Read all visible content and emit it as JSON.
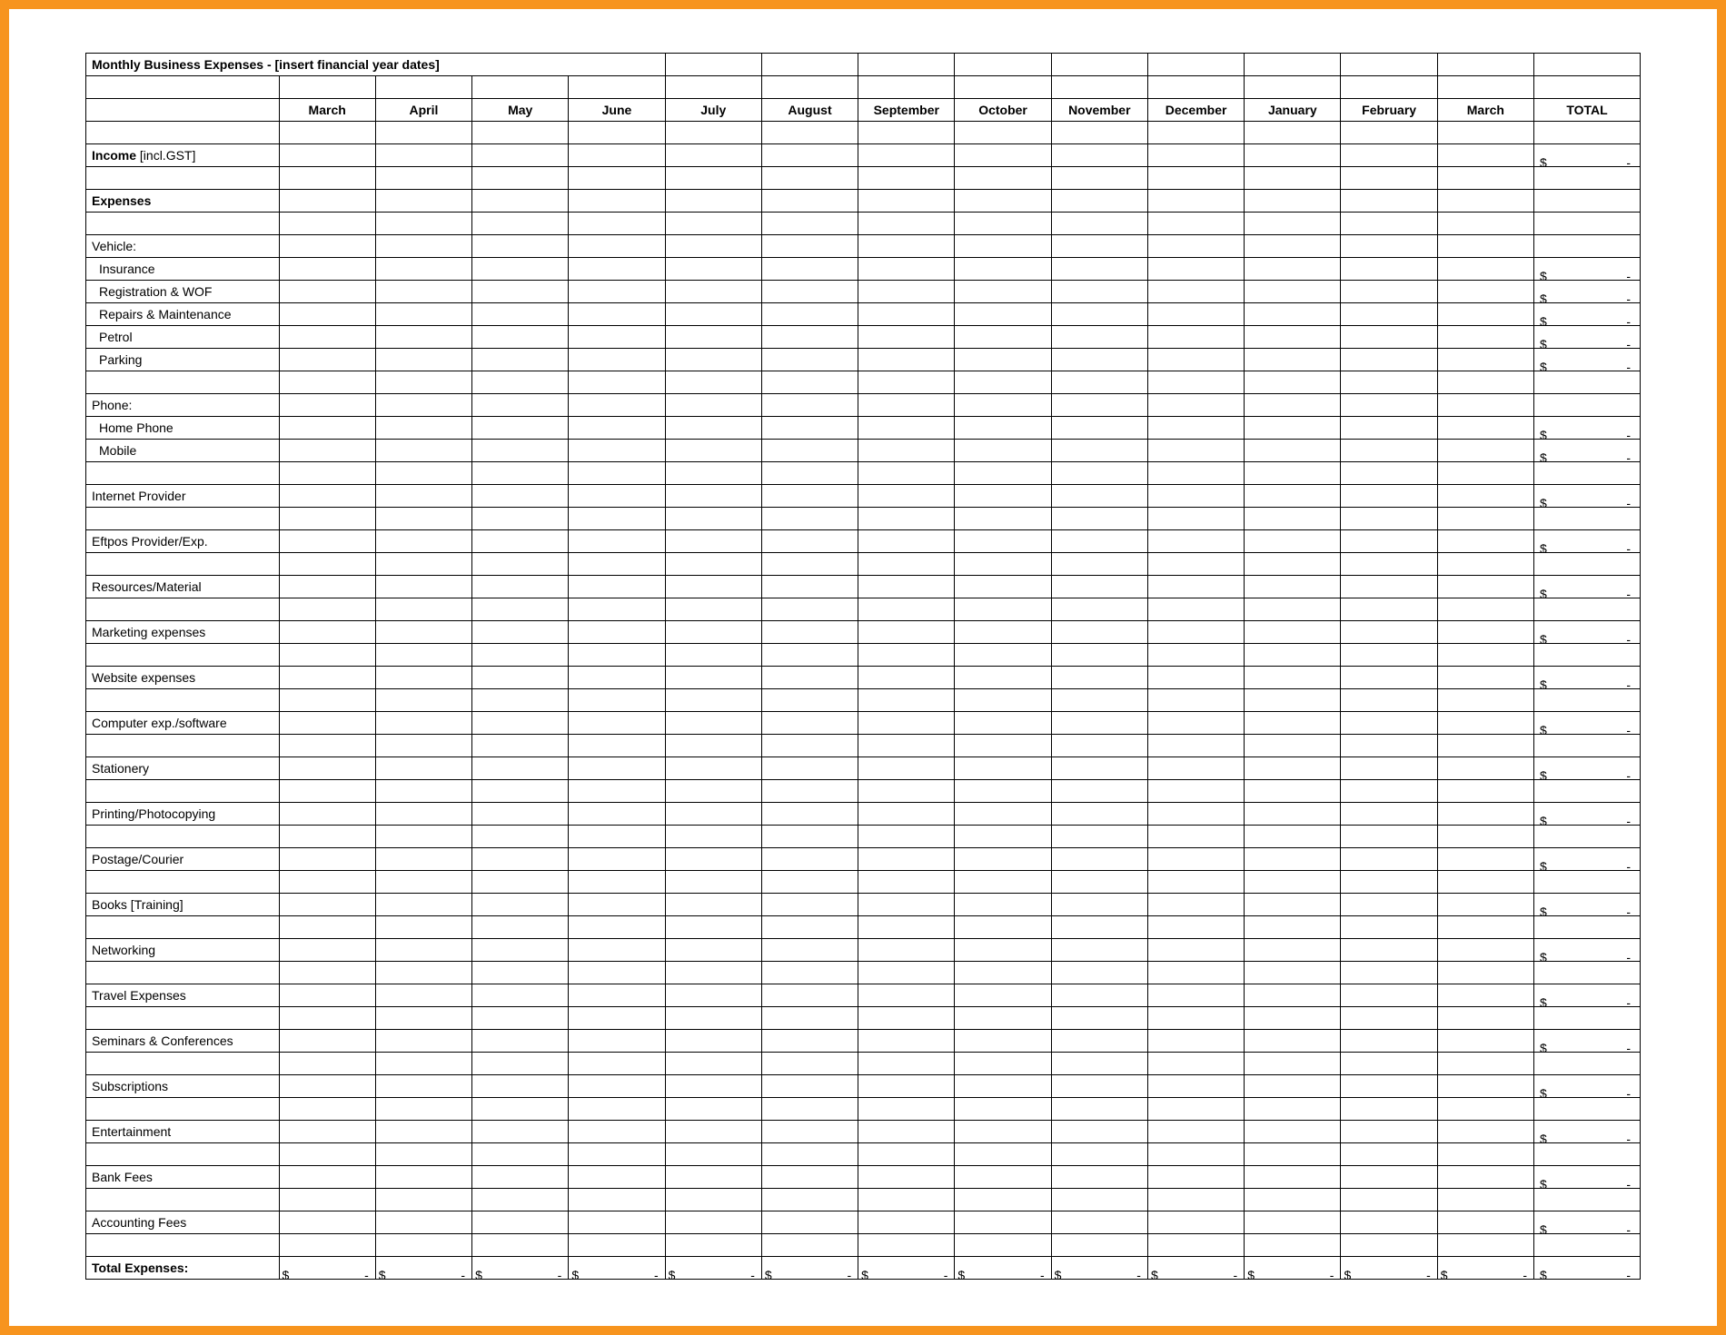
{
  "title": "Monthly Business Expenses - [insert financial year dates]",
  "headers": [
    "March",
    "April",
    "May",
    "June",
    "July",
    "August",
    "September",
    "October",
    "November",
    "December",
    "January",
    "February",
    "March",
    "TOTAL"
  ],
  "income_label_bold": "Income",
  "income_label_plain": " [incl.GST]",
  "expenses_label": "Expenses",
  "currency_symbol": "$",
  "dash": "-",
  "rows": [
    {
      "type": "blank"
    },
    {
      "type": "section",
      "label": "Vehicle:"
    },
    {
      "type": "item",
      "label": "Insurance",
      "indent": true,
      "total": true
    },
    {
      "type": "item",
      "label": "Registration & WOF",
      "indent": true,
      "total": true
    },
    {
      "type": "item",
      "label": "Repairs & Maintenance",
      "indent": true,
      "total": true
    },
    {
      "type": "item",
      "label": "Petrol",
      "indent": true,
      "total": true
    },
    {
      "type": "item",
      "label": "Parking",
      "indent": true,
      "total": true
    },
    {
      "type": "blank"
    },
    {
      "type": "section",
      "label": "Phone:"
    },
    {
      "type": "item",
      "label": "Home Phone",
      "indent": true,
      "total": true
    },
    {
      "type": "item",
      "label": "Mobile",
      "indent": true,
      "total": true
    },
    {
      "type": "blank"
    },
    {
      "type": "item",
      "label": "Internet Provider",
      "total": true
    },
    {
      "type": "blank"
    },
    {
      "type": "item",
      "label": "Eftpos Provider/Exp.",
      "total": true
    },
    {
      "type": "blank"
    },
    {
      "type": "item",
      "label": "Resources/Material",
      "total": true
    },
    {
      "type": "blank"
    },
    {
      "type": "item",
      "label": "Marketing expenses",
      "total": true
    },
    {
      "type": "blank"
    },
    {
      "type": "item",
      "label": "Website expenses",
      "total": true
    },
    {
      "type": "blank"
    },
    {
      "type": "item",
      "label": "Computer exp./software",
      "total": true
    },
    {
      "type": "blank"
    },
    {
      "type": "item",
      "label": "Stationery",
      "total": true
    },
    {
      "type": "blank"
    },
    {
      "type": "item",
      "label": "Printing/Photocopying",
      "total": true
    },
    {
      "type": "blank"
    },
    {
      "type": "item",
      "label": "Postage/Courier",
      "total": true
    },
    {
      "type": "blank"
    },
    {
      "type": "item",
      "label": "Books [Training]",
      "total": true
    },
    {
      "type": "blank"
    },
    {
      "type": "item",
      "label": "Networking",
      "total": true
    },
    {
      "type": "blank"
    },
    {
      "type": "item",
      "label": "Travel Expenses",
      "total": true
    },
    {
      "type": "blank"
    },
    {
      "type": "item",
      "label": "Seminars & Conferences",
      "total": true
    },
    {
      "type": "blank"
    },
    {
      "type": "item",
      "label": "Subscriptions",
      "total": true
    },
    {
      "type": "blank"
    },
    {
      "type": "item",
      "label": "Entertainment",
      "total": true
    },
    {
      "type": "blank"
    },
    {
      "type": "item",
      "label": "Bank Fees",
      "total": true
    },
    {
      "type": "blank"
    },
    {
      "type": "item",
      "label": "Accounting Fees",
      "total": true
    },
    {
      "type": "blank"
    }
  ],
  "total_expenses_label": "Total Expenses:"
}
